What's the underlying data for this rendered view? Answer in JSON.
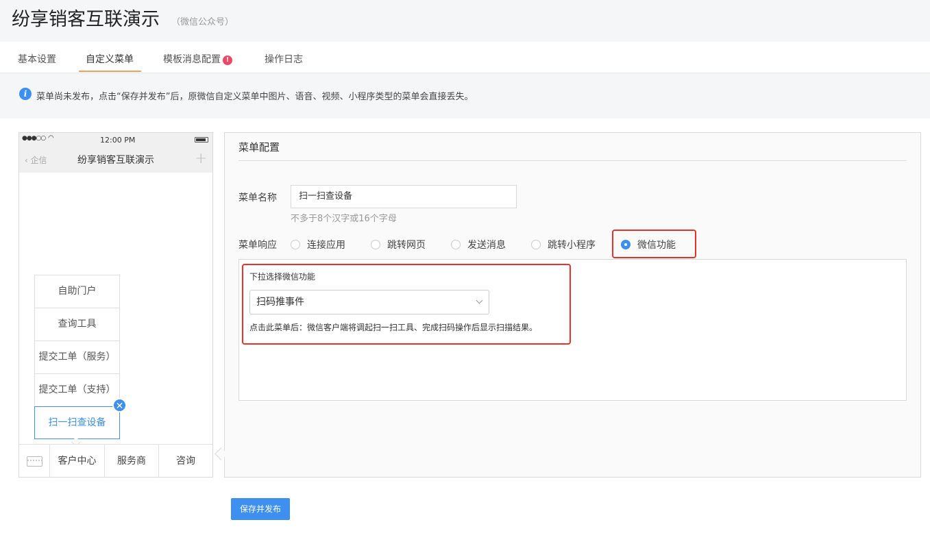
{
  "header": {
    "title": "纷享销客互联演示",
    "subtitle": "（微信公众号）"
  },
  "tabs": [
    {
      "label": "基本设置"
    },
    {
      "label": "自定义菜单",
      "active": true
    },
    {
      "label": "模板消息配置",
      "badge": "!"
    },
    {
      "label": "操作日志"
    }
  ],
  "notice": {
    "text": "菜单尚未发布，点击“保存并发布”后，原微信自定义菜单中图片、语音、视频、小程序类型的菜单会直接丢失。"
  },
  "phone": {
    "time": "12:00 PM",
    "back_label": "企信",
    "title": "纷享销客互联演示",
    "submenu": [
      "自助门户",
      "查询工具",
      "提交工单（服务）",
      "提交工单（支持）",
      "扫一扫查设备"
    ],
    "bottom_menu": [
      "客户中心",
      "服务商",
      "咨询"
    ]
  },
  "config": {
    "title": "菜单配置",
    "name_label": "菜单名称",
    "name_value": "扫一扫查设备",
    "name_hint": "不多于8个汉字或16个字母",
    "response_label": "菜单响应",
    "response_options": [
      "连接应用",
      "跳转网页",
      "发送消息",
      "跳转小程序",
      "微信功能"
    ],
    "selected_response": "微信功能",
    "func_label": "下拉选择微信功能",
    "func_selected": "扫码推事件",
    "func_desc": "点击此菜单后：微信客户端将调起扫一扫工具、完成扫码操作后显示扫描结果。"
  },
  "publish_label": "保存并发布",
  "colors": {
    "accent": "#3d8ff0",
    "highlight": "#e8312a",
    "tab_underline": "#f0a05a"
  }
}
